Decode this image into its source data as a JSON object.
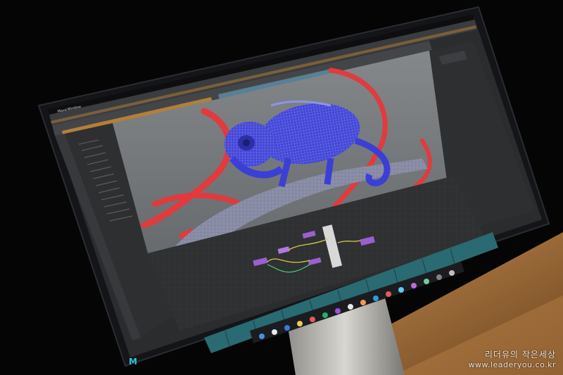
{
  "scene": {
    "description_icon": "monitor-photo",
    "colors": {
      "background": "#060505",
      "desk": "#8a5a2e",
      "bezel": "#15171a",
      "viewport": "#6f7376",
      "mesh_blue": "#3b3fd6",
      "ribbon_red": "#e23a3d",
      "node_graph": "#3a3b3d",
      "dock": "#1a1b1d"
    }
  },
  "app": {
    "menu_app": "Maya",
    "menu_item": "Window"
  },
  "watermark": {
    "line1": "리더유의 작은세상",
    "line2": "www.leaderyou.co.kr"
  }
}
